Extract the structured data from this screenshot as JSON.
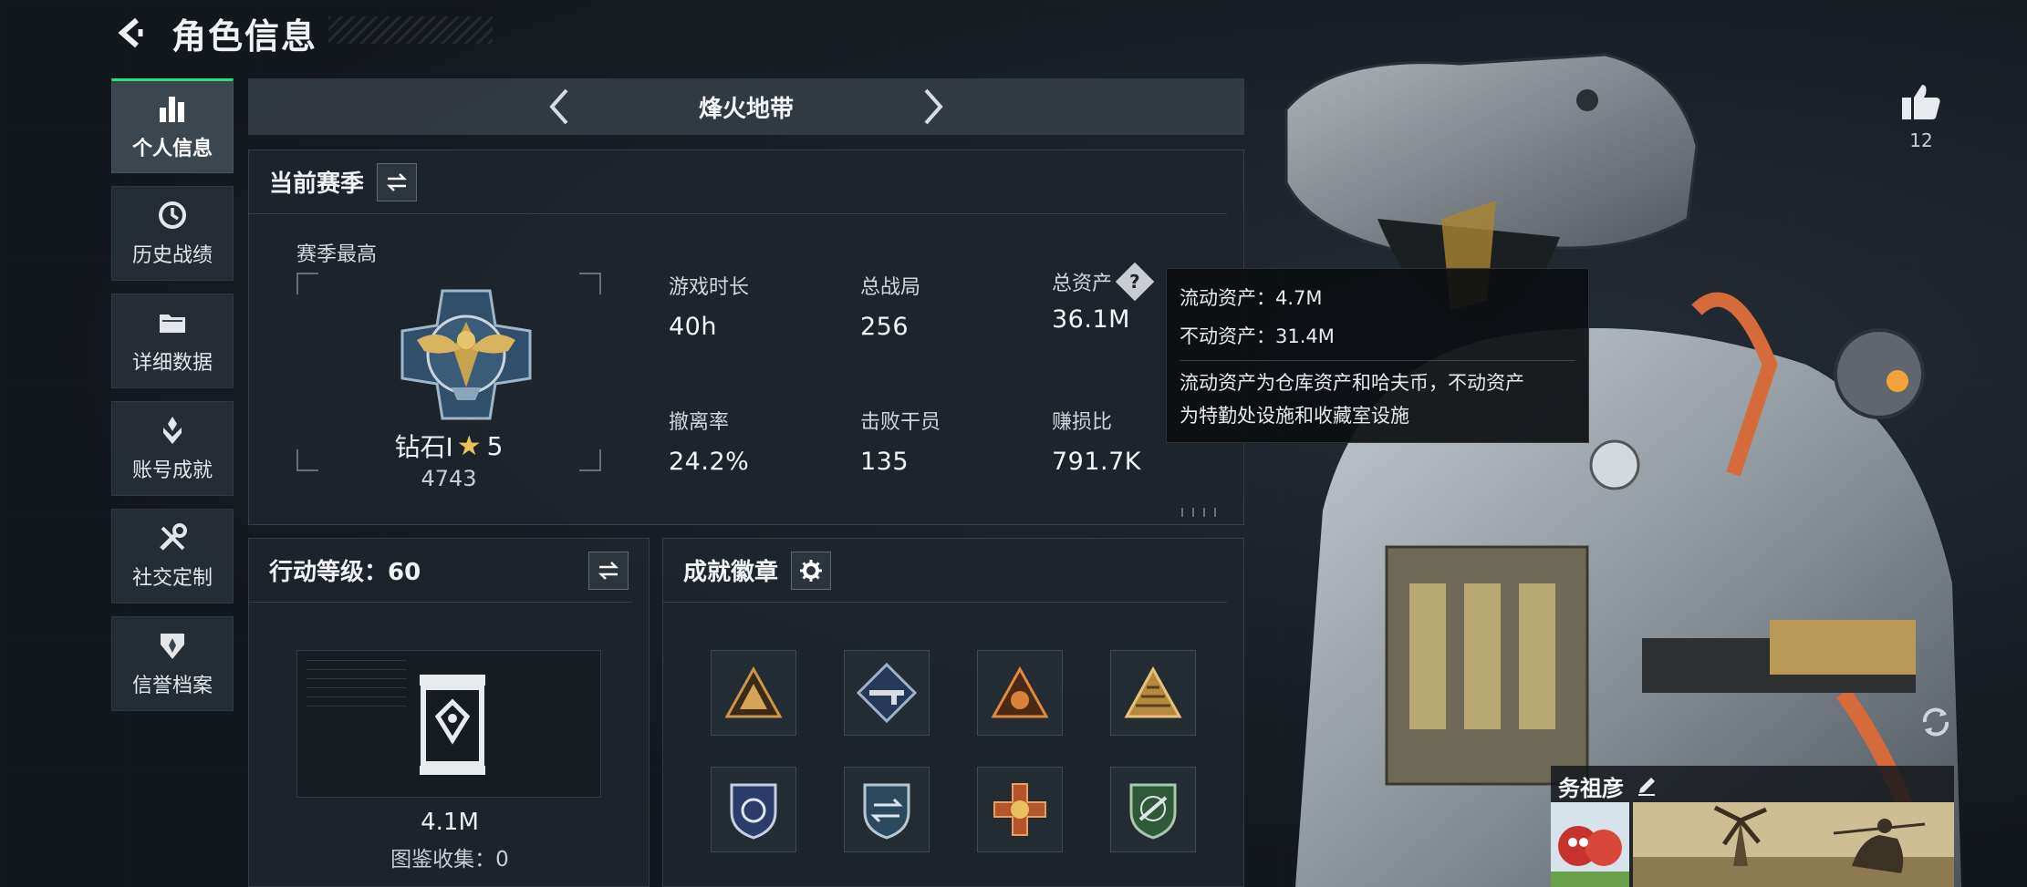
{
  "header": {
    "title": "角色信息"
  },
  "nav": {
    "items": [
      {
        "label": "个人信息",
        "icon": "bar-chart-icon",
        "active": true
      },
      {
        "label": "历史战绩",
        "icon": "history-clock-icon",
        "active": false
      },
      {
        "label": "详细数据",
        "icon": "folder-icon",
        "active": false
      },
      {
        "label": "账号成就",
        "icon": "achievement-icon",
        "active": false
      },
      {
        "label": "社交定制",
        "icon": "tools-icon",
        "active": false
      },
      {
        "label": "信誉档案",
        "icon": "reputation-icon",
        "active": false
      }
    ]
  },
  "mode": {
    "name": "烽火地带"
  },
  "season": {
    "title": "当前赛季",
    "best_label": "赛季最高",
    "rank_name": "钻石I",
    "rank_stars": "5",
    "rank_score": "4743",
    "stats": [
      {
        "key": "游戏时长",
        "value": "40h"
      },
      {
        "key": "总战局",
        "value": "256"
      },
      {
        "key": "总资产",
        "value": "36.1M"
      },
      {
        "key": "撤离率",
        "value": "24.2%"
      },
      {
        "key": "击败干员",
        "value": "135"
      },
      {
        "key": "赚损比",
        "value": "791.7K"
      }
    ]
  },
  "tooltip": {
    "liquid": "流动资产：4.7M",
    "fixed": "不动资产：31.4M",
    "description_line1": "流动资产为仓库资产和哈夫币，不动资产",
    "description_line2": "为特勤处设施和收藏室设施"
  },
  "level": {
    "title": "行动等级：60",
    "collection_value": "4.1M",
    "collection_label": "图鉴收集：0"
  },
  "badges": {
    "title": "成就徽章",
    "items": [
      {
        "icon": "gold-triangle-badge-icon"
      },
      {
        "icon": "rifle-diamond-badge-icon"
      },
      {
        "icon": "orange-triangle-badge-icon"
      },
      {
        "icon": "gold-pyramid-badge-icon"
      },
      {
        "icon": "blue-shield-badge-icon"
      },
      {
        "icon": "arrows-shield-badge-icon"
      },
      {
        "icon": "orange-cross-badge-icon"
      },
      {
        "icon": "green-rifle-shield-badge-icon"
      }
    ]
  },
  "social": {
    "like_count": "12"
  },
  "player": {
    "name": "务祖彦"
  },
  "colors": {
    "accent": "#2ee07a",
    "background": "#1a2027",
    "panel": "#1e252c"
  }
}
